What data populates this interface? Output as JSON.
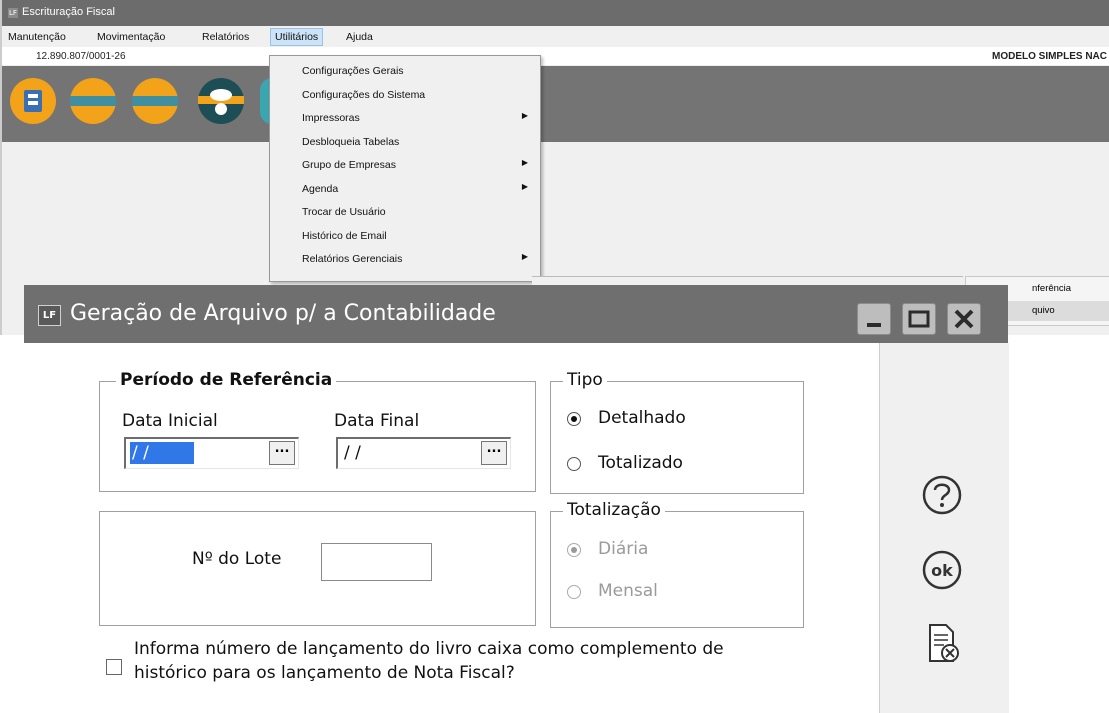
{
  "main_window": {
    "title": "Escrituração Fiscal",
    "logo_text": "LF",
    "menu": [
      "Manutenção",
      "Movimentação",
      "Relatórios",
      "Utilitários",
      "Ajuda"
    ],
    "cnpj": "12.890.807/0001-26",
    "modelo": "MODELO SIMPLES NAC",
    "toolbar_icons": [
      "nfe-icon",
      "sped-contribuicoes-icon",
      "sped-icms-ipi-icon",
      "cloud-download-icon"
    ],
    "right_panel_items": [
      "nferência",
      "quivo"
    ]
  },
  "dropdown": {
    "items": [
      {
        "label": "Configurações Gerais",
        "has_submenu": false
      },
      {
        "label": "Configurações do Sistema",
        "has_submenu": false
      },
      {
        "label": "Impressoras",
        "has_submenu": true
      },
      {
        "label": "Desbloqueia Tabelas",
        "has_submenu": false
      },
      {
        "label": "Grupo de Empresas",
        "has_submenu": true
      },
      {
        "label": "Agenda",
        "has_submenu": true
      },
      {
        "label": "Trocar de Usuário",
        "has_submenu": false
      },
      {
        "label": "Histórico de Email",
        "has_submenu": false
      },
      {
        "label": "Relatórios Gerenciais",
        "has_submenu": true
      }
    ],
    "arrow_glyph": "▶"
  },
  "dialog": {
    "logo_text": "LF",
    "title": "Geração de Arquivo p/ a Contabilidade",
    "periodo": {
      "legend": "Período de Referência",
      "data_inicial_label": "Data Inicial",
      "data_inicial_value": "/ /",
      "data_final_label": "Data Final",
      "data_final_value": "/ /",
      "picker_glyph": "..."
    },
    "tipo": {
      "legend": "Tipo",
      "options": [
        {
          "label": "Detalhado",
          "checked": true
        },
        {
          "label": "Totalizado",
          "checked": false
        }
      ]
    },
    "lote": {
      "label": "Nº do Lote",
      "value": ""
    },
    "totalizacao": {
      "legend": "Totalização",
      "disabled": true,
      "options": [
        {
          "label": "Diária",
          "checked": true
        },
        {
          "label": "Mensal",
          "checked": false
        }
      ]
    },
    "checkbox": {
      "checked": false,
      "label_line1": "Informa número de lançamento do livro caixa como complemento de",
      "label_line2": "histórico para os lançamento de Nota Fiscal?"
    }
  },
  "colors": {
    "titlebar": "#6f6f6f",
    "selection": "#3078e8",
    "menu_highlight": "#cde3f7"
  }
}
